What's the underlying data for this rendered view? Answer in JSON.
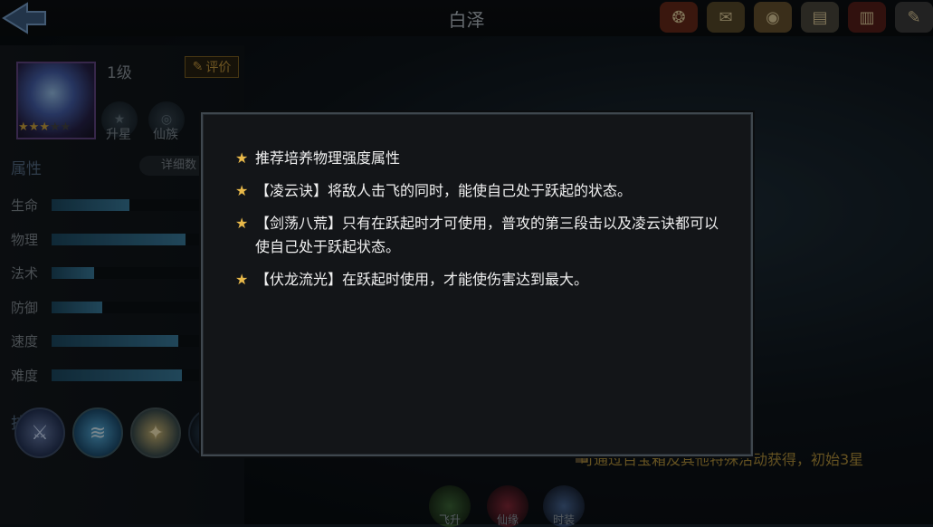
{
  "header": {
    "title": "白泽"
  },
  "top_icons": [
    {
      "name": "seal-icon",
      "glyph": "❂",
      "bg": "#6b2a1a"
    },
    {
      "name": "scroll-icon",
      "glyph": "✉",
      "bg": "#5a4b2a"
    },
    {
      "name": "token-icon",
      "glyph": "◉",
      "bg": "#6a5530"
    },
    {
      "name": "document-icon",
      "glyph": "▤",
      "bg": "#4d4a3f"
    },
    {
      "name": "book-icon",
      "glyph": "▥",
      "bg": "#5a1f1a"
    },
    {
      "name": "wrench-icon",
      "glyph": "✎",
      "bg": "#3f3f3f"
    }
  ],
  "hero": {
    "level": "1级",
    "rate_label": "评价",
    "stars_filled": 3,
    "stars_total": 5,
    "buttons": [
      "升星",
      "仙族"
    ]
  },
  "attributes": {
    "title": "属性",
    "detail_label": "详细数",
    "stats": [
      {
        "label": "生命",
        "value": 0.48
      },
      {
        "label": "物理",
        "value": 0.82
      },
      {
        "label": "法术",
        "value": 0.26
      },
      {
        "label": "防御",
        "value": 0.31
      },
      {
        "label": "速度",
        "value": 0.78
      },
      {
        "label": "难度",
        "value": 0.8
      }
    ]
  },
  "skills": {
    "title": "技能"
  },
  "acquire_text": "可通过百宝箱及其他特殊活动获得，初始3星",
  "bottom_tabs": [
    "飞升",
    "仙缘",
    "时装"
  ],
  "tips": [
    "推荐培养物理强度属性",
    "【凌云诀】将敌人击飞的同时，能使自己处于跃起的状态。",
    "【剑荡八荒】只有在跃起时才可使用，普攻的第三段击以及凌云诀都可以使自己处于跃起状态。",
    "【伏龙流光】在跃起时使用，才能使伤害达到最大。"
  ]
}
